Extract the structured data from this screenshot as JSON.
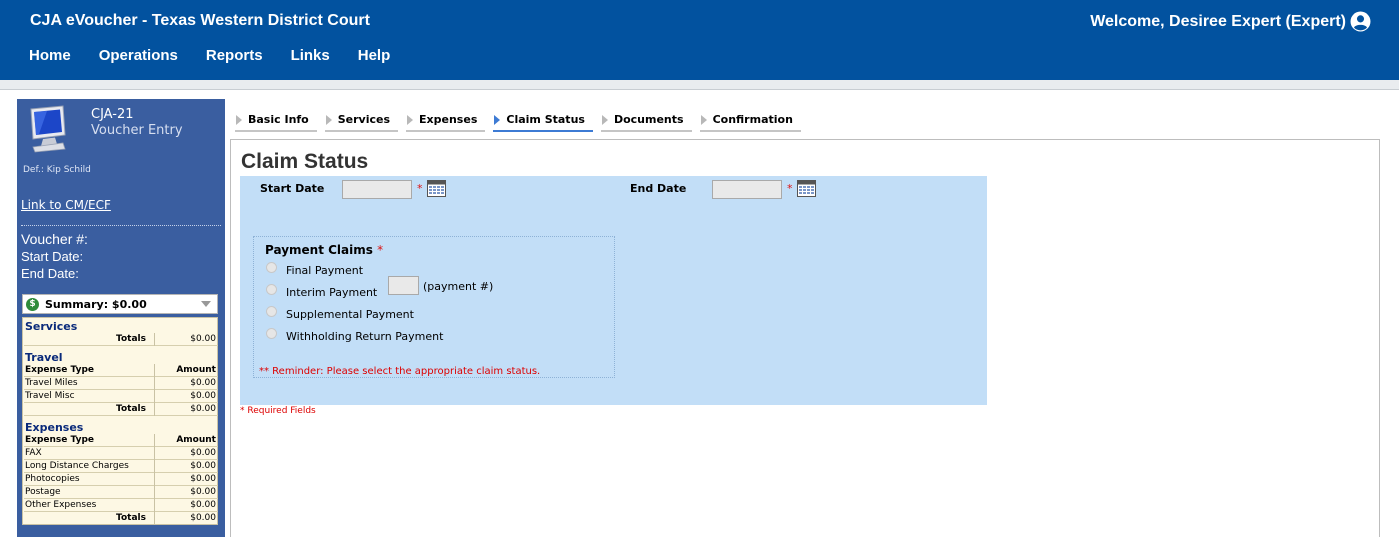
{
  "header": {
    "app_title": "CJA eVoucher - Texas Western District Court",
    "welcome": "Welcome, Desiree Expert (Expert)",
    "nav": [
      "Home",
      "Operations",
      "Reports",
      "Links",
      "Help"
    ]
  },
  "sidebar": {
    "form_code": "CJA-21",
    "form_title": "Voucher Entry",
    "defendant": "Def.: Kip Schild",
    "link_cmecf": "Link to CM/ECF",
    "voucher_label": "Voucher #:",
    "start_date_label": "Start Date:",
    "end_date_label": "End Date:",
    "summary_label": "Summary: $0.00",
    "summary": {
      "services": {
        "title": "Services",
        "totals_label": "Totals",
        "totals_value": "$0.00"
      },
      "travel": {
        "title": "Travel",
        "col_type": "Expense Type",
        "col_amount": "Amount",
        "rows": [
          {
            "label": "Travel Miles",
            "value": "$0.00"
          },
          {
            "label": "Travel Misc",
            "value": "$0.00"
          }
        ],
        "totals_label": "Totals",
        "totals_value": "$0.00"
      },
      "expenses": {
        "title": "Expenses",
        "col_type": "Expense Type",
        "col_amount": "Amount",
        "rows": [
          {
            "label": "FAX",
            "value": "$0.00"
          },
          {
            "label": "Long Distance Charges",
            "value": "$0.00"
          },
          {
            "label": "Photocopies",
            "value": "$0.00"
          },
          {
            "label": "Postage",
            "value": "$0.00"
          },
          {
            "label": "Other Expenses",
            "value": "$0.00"
          }
        ],
        "totals_label": "Totals",
        "totals_value": "$0.00"
      }
    }
  },
  "tabs": [
    "Basic Info",
    "Services",
    "Expenses",
    "Claim Status",
    "Documents",
    "Confirmation"
  ],
  "active_tab": "Claim Status",
  "main": {
    "title": "Claim Status",
    "start_date_label": "Start Date",
    "end_date_label": "End Date",
    "required_mark": "*",
    "payment_claims_title": "Payment Claims",
    "payment_options": [
      "Final Payment",
      "Interim Payment",
      "Supplemental Payment",
      "Withholding Return Payment"
    ],
    "payment_number_label": "(payment #)",
    "reminder": "** Reminder: Please select the appropriate claim status.",
    "required_note": "* Required Fields"
  },
  "colors": {
    "header_bg": "#02529f",
    "sidebar_bg": "#3a5ea0",
    "form_bg": "#c2def7",
    "active_tab": "#3d7bd4",
    "required": "#dd1111"
  }
}
